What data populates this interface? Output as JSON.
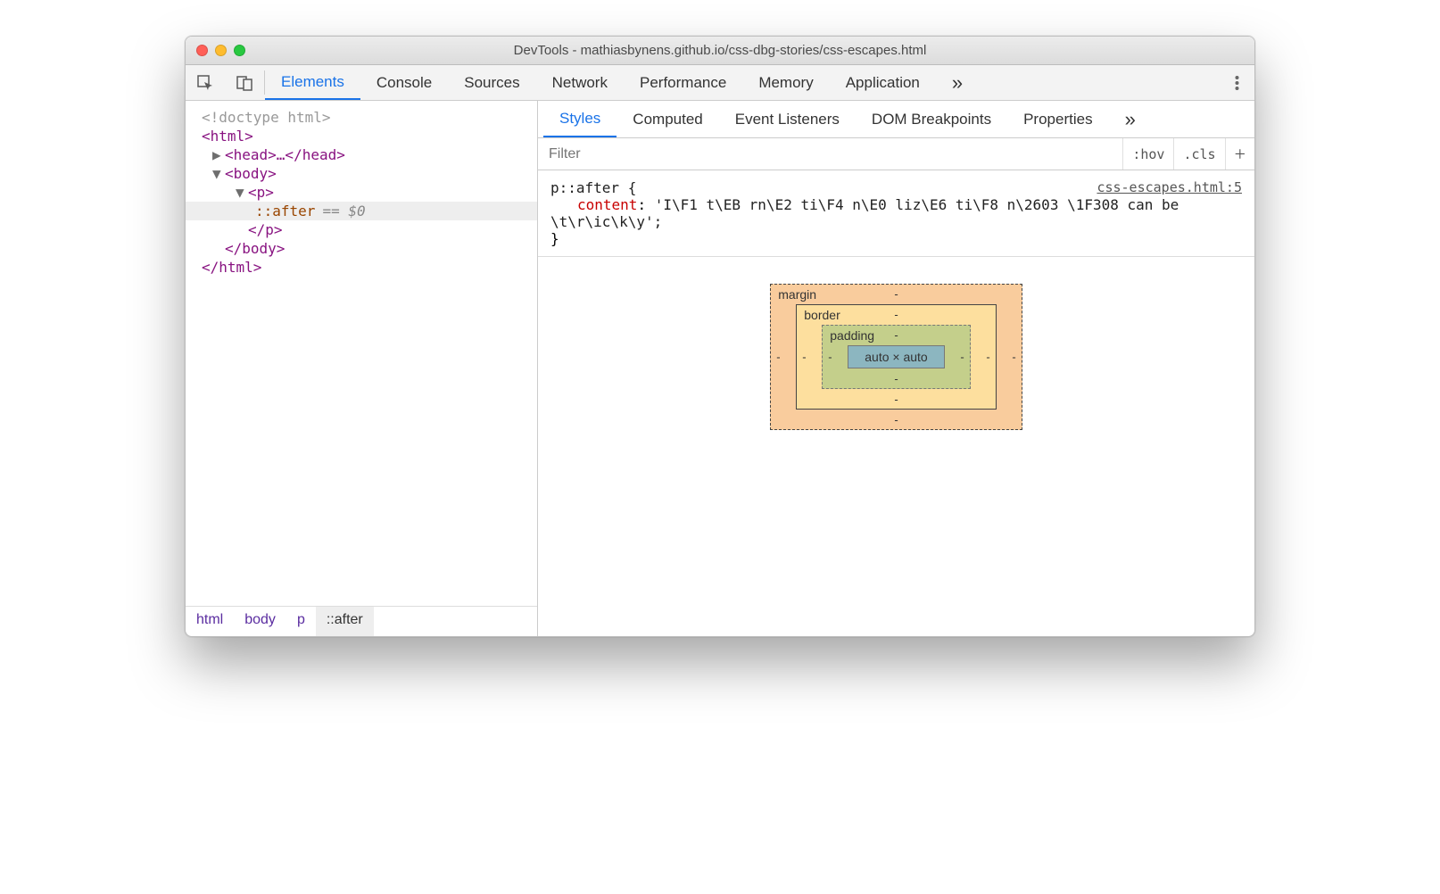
{
  "window": {
    "title": "DevTools - mathiasbynens.github.io/css-dbg-stories/css-escapes.html"
  },
  "mainTabs": {
    "items": [
      "Elements",
      "Console",
      "Sources",
      "Network",
      "Performance",
      "Memory",
      "Application"
    ],
    "activeIndex": 0,
    "more": "»"
  },
  "domTree": {
    "doctype": "<!doctype html>",
    "htmlOpen": "<html>",
    "headCollapsed": "<head>…</head>",
    "bodyOpen": "<body>",
    "pOpen": "<p>",
    "afterPseudo": "::after",
    "eqDollar": "== $0",
    "pClose": "</p>",
    "bodyClose": "</body>",
    "htmlClose": "</html>"
  },
  "breadcrumbs": [
    "html",
    "body",
    "p",
    "::after"
  ],
  "stylesTabs": {
    "items": [
      "Styles",
      "Computed",
      "Event Listeners",
      "DOM Breakpoints",
      "Properties"
    ],
    "activeIndex": 0,
    "more": "»"
  },
  "filter": {
    "placeholder": "Filter",
    "hov": ":hov",
    "cls": ".cls",
    "plus": "+"
  },
  "cssRule": {
    "selector": "p::after {",
    "prop": "content",
    "value": "'I\\F1 t\\EB rn\\E2 ti\\F4 n\\E0 liz\\E6 ti\\F8 n\\2603 \\1F308 can be \\t\\r\\ic\\k\\y';",
    "close": "}",
    "source": "css-escapes.html:5"
  },
  "boxModel": {
    "margin": {
      "label": "margin",
      "top": "-",
      "right": "-",
      "bottom": "-",
      "left": "-"
    },
    "border": {
      "label": "border",
      "top": "-",
      "right": "-",
      "bottom": "-",
      "left": "-"
    },
    "padding": {
      "label": "padding",
      "top": "-",
      "right": "-",
      "bottom": "-",
      "left": "-"
    },
    "content": "auto × auto"
  }
}
